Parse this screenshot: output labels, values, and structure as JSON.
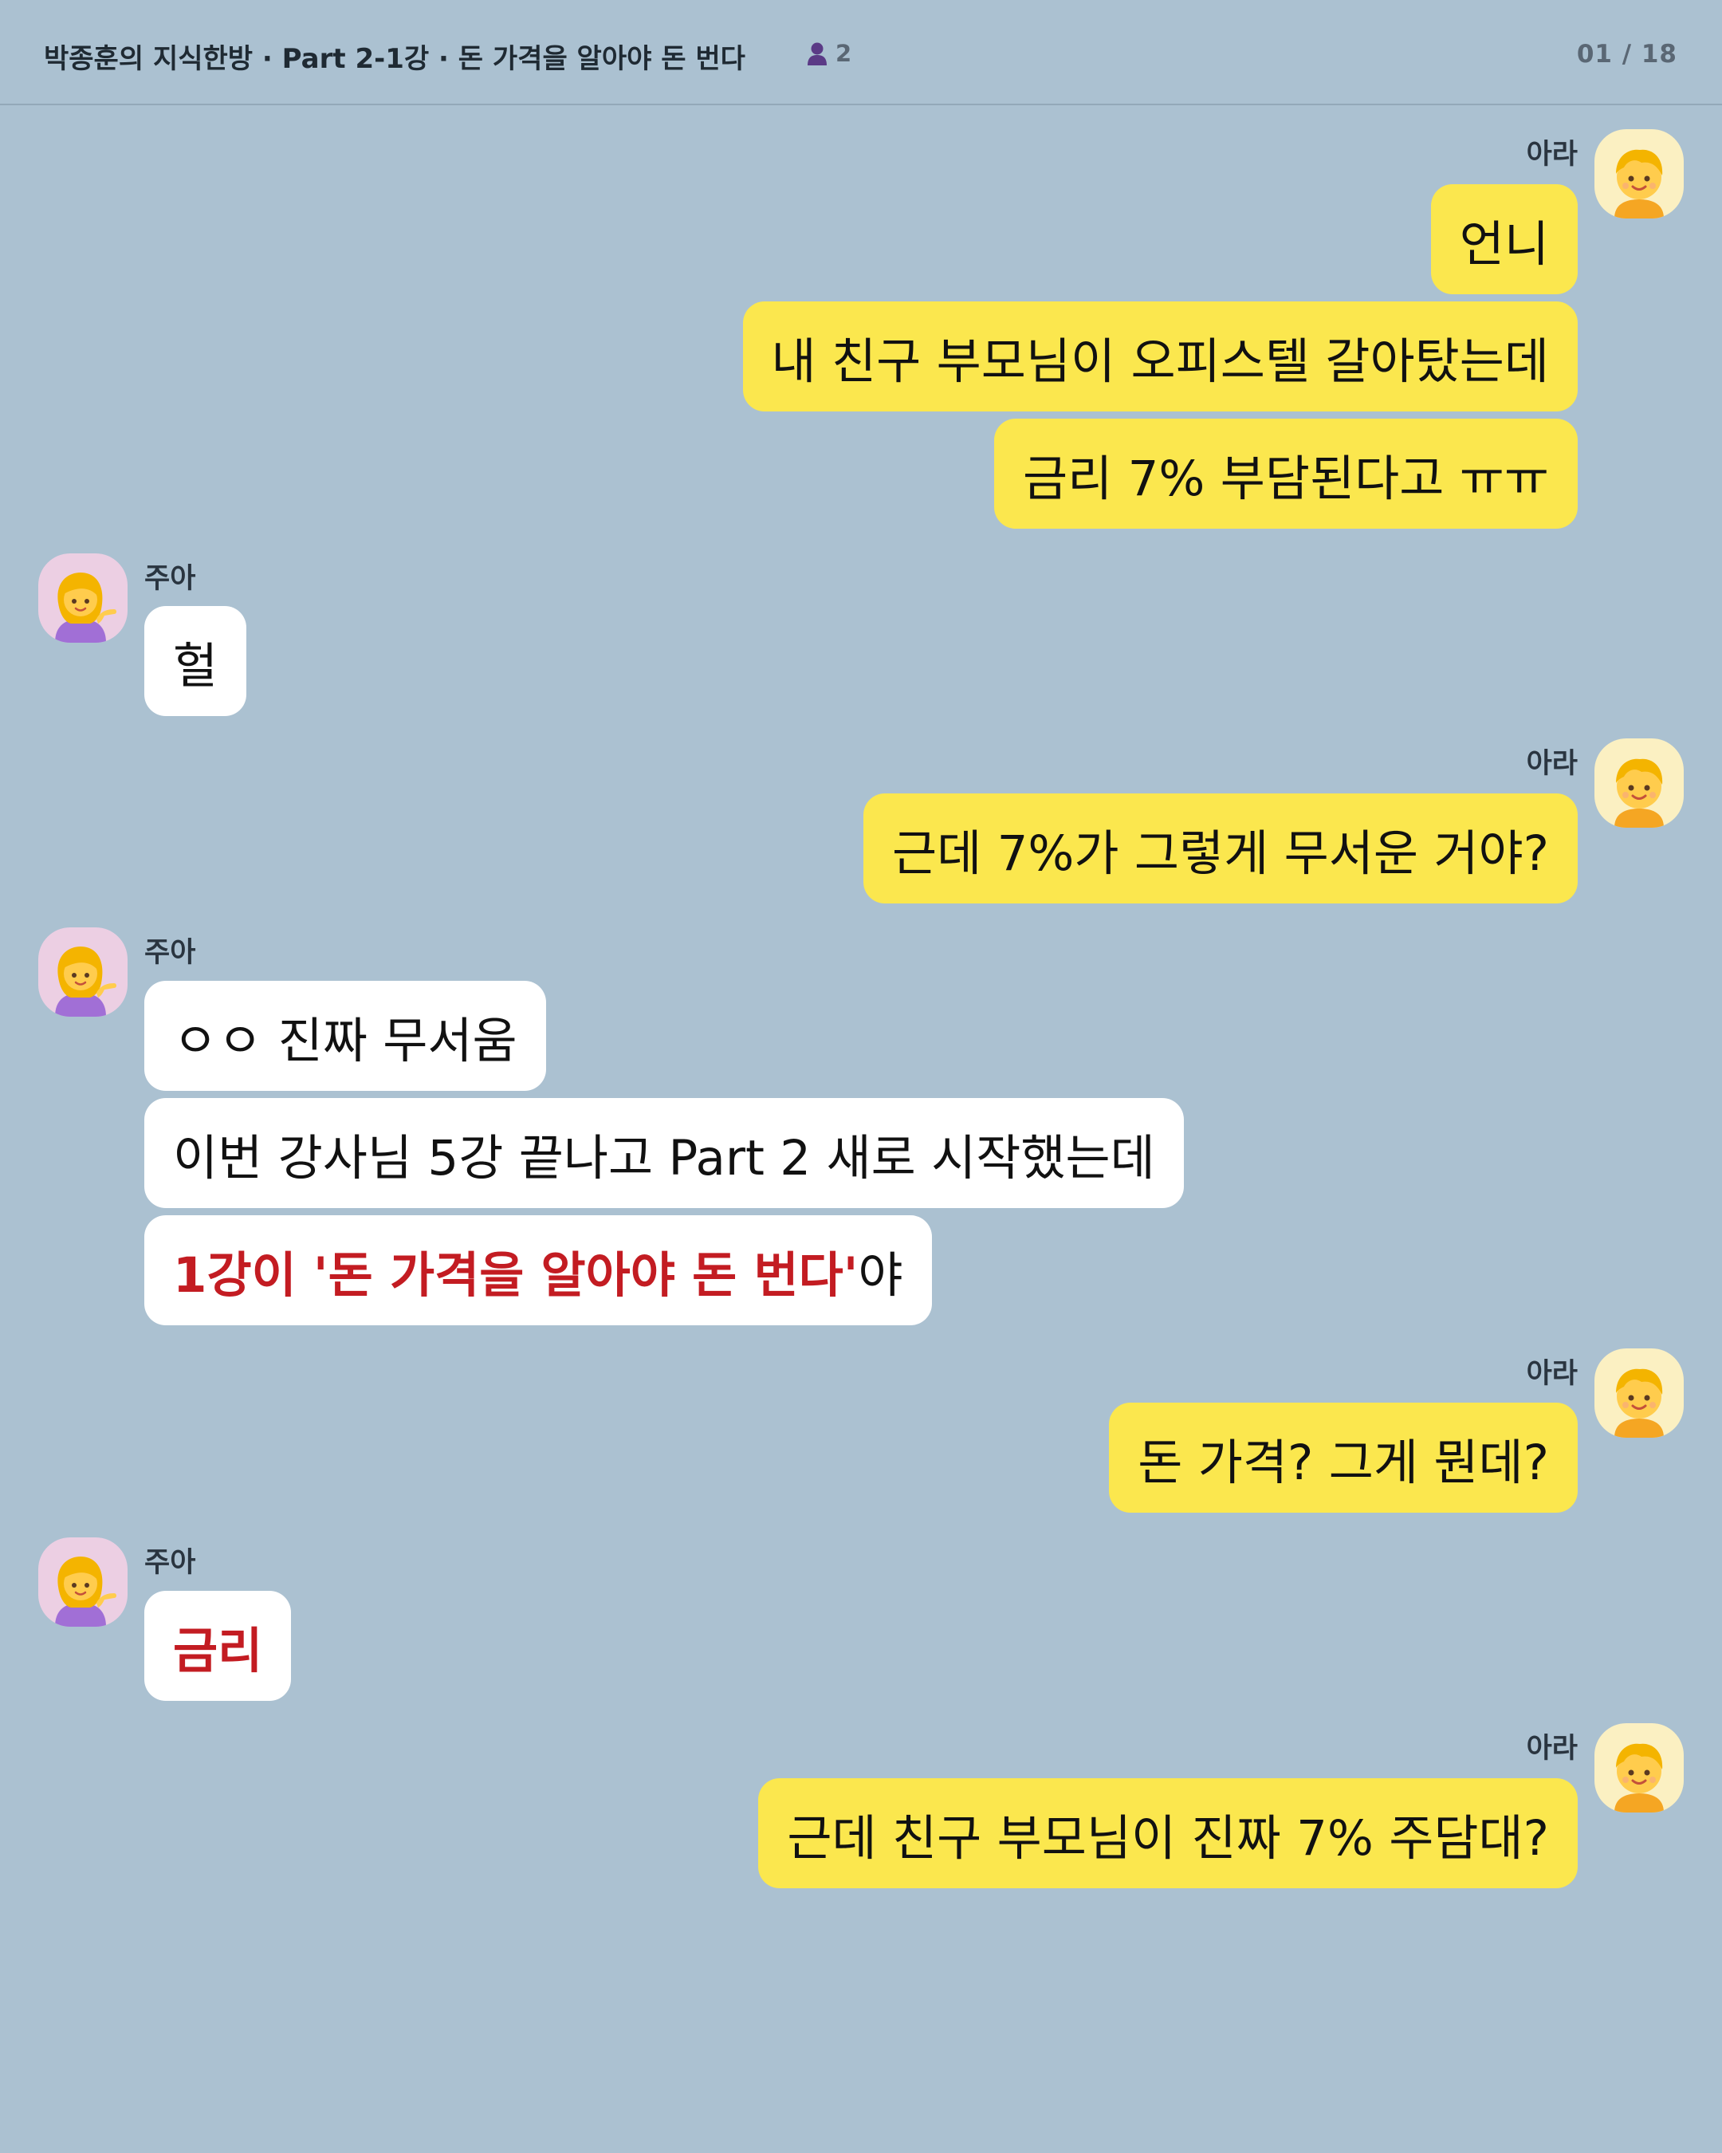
{
  "header": {
    "title": "박종훈의 지식한방 · Part 2-1강 · 돈 가격을 알아야 돈 번다",
    "member_count": "2",
    "page_indicator": "01 / 18"
  },
  "icons": {
    "members": "person-icon",
    "ara_avatar": "blond-child-emoji",
    "jua_avatar": "tipping-hand-woman-emoji"
  },
  "colors": {
    "background": "#abc1d1",
    "my_bubble": "#fbe74e",
    "other_bubble": "#ffffff",
    "highlight": "#c31c22"
  },
  "chat": {
    "g1": {
      "sender": "아라",
      "m1": "언니",
      "m2": "내 친구 부모님이 오피스텔 갈아탔는데",
      "m3": "금리 7% 부담된다고 ㅠㅠ"
    },
    "g2": {
      "sender": "주아",
      "m1": "헐"
    },
    "g3": {
      "sender": "아라",
      "m1": "근데 7%가 그렇게 무서운 거야?"
    },
    "g4": {
      "sender": "주아",
      "m1": "ㅇㅇ 진짜 무서움",
      "m2": "이번 강사님 5강 끝나고 Part 2 새로 시작했는데",
      "m3_highlight": "1강이 '돈 가격을 알아야 돈 번다'",
      "m3_tail": "야"
    },
    "g5": {
      "sender": "아라",
      "m1": "돈 가격? 그게 뭔데?"
    },
    "g6": {
      "sender": "주아",
      "m1_highlight": "금리"
    },
    "g7": {
      "sender": "아라",
      "m1": "근데 친구 부모님이 진짜 7% 주담대?"
    }
  }
}
